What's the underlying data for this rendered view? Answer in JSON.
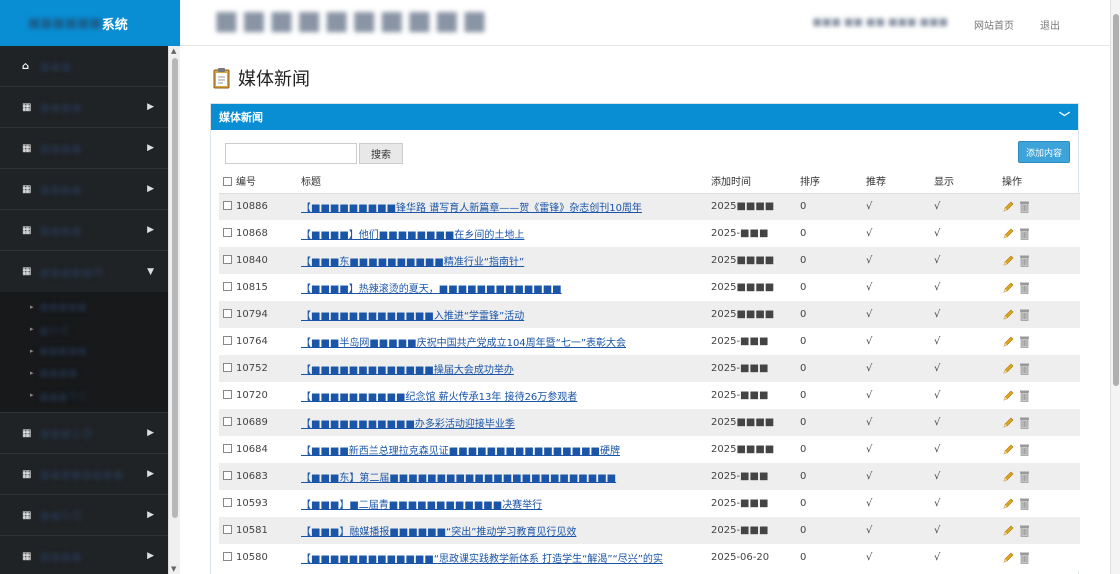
{
  "app": {
    "brand_suffix": "系统",
    "brand_prefix_masked": "■■■■■■",
    "site_title_masked": "■■■■■■■■■■"
  },
  "header": {
    "user_info_masked": "■■■ ■■ ■■ ■■■ ■■■",
    "home_link": "网站首页",
    "logout_link": "退出"
  },
  "sidebar": {
    "items": [
      {
        "label": "■■■",
        "icon": "home-icon",
        "arrow": "",
        "open": false
      },
      {
        "label": "■■■■",
        "icon": "grid-icon",
        "arrow": "▶",
        "open": false
      },
      {
        "label": "■■■■",
        "icon": "grid-icon",
        "arrow": "▶",
        "open": false
      },
      {
        "label": "■■■■",
        "icon": "grid-icon",
        "arrow": "▶",
        "open": false
      },
      {
        "label": "■■■■",
        "icon": "grid-icon",
        "arrow": "▶",
        "open": false
      },
      {
        "label": "■■■■■闻",
        "icon": "grid-icon",
        "arrow": "▼",
        "open": true
      },
      {
        "label": "■■■公告",
        "icon": "grid-icon",
        "arrow": "▶",
        "open": false
      },
      {
        "label": "■■■■■■■■",
        "icon": "grid-icon",
        "arrow": "▶",
        "open": false
      },
      {
        "label": "■■队伍",
        "icon": "grid-icon",
        "arrow": "▶",
        "open": false
      },
      {
        "label": "■■■■",
        "icon": "grid-icon",
        "arrow": "▶",
        "open": false
      }
    ],
    "submenu": [
      "■■■■■",
      "■新闻",
      "■■■■■",
      "■■■■",
      "■■■专栏"
    ]
  },
  "main": {
    "page_title": "媒体新闻",
    "panel_title": "媒体新闻",
    "search_button": "搜索",
    "search_value": "",
    "add_button": "添加内容",
    "columns": {
      "id": "编号",
      "title": "标题",
      "date": "添加时间",
      "sort": "排序",
      "recommend": "推荐",
      "show": "显示",
      "ops": "操作"
    },
    "rows": [
      {
        "id": "10886",
        "title": "【■■■■■■■■■锋华路 谱写育人新篇章——贺《雷锋》杂志创刊10周年",
        "date": "2025■■■■",
        "sort": "0",
        "recommend": "√",
        "show": "√"
      },
      {
        "id": "10868",
        "title": "【■■■■】他们■■■■■■■■在乡间的土地上",
        "date": "2025-■■■",
        "sort": "0",
        "recommend": "√",
        "show": "√"
      },
      {
        "id": "10840",
        "title": "【■■■东■■■■■■■■■■精准行业“指南针”",
        "date": "2025■■■■",
        "sort": "0",
        "recommend": "√",
        "show": "√"
      },
      {
        "id": "10815",
        "title": "【■■■■】热辣滚烫的夏天，■■■■■■■■■■■■■",
        "date": "2025■■■■",
        "sort": "0",
        "recommend": "√",
        "show": "√"
      },
      {
        "id": "10794",
        "title": "【■■■■■■■■■■■■■入推进“学雷锋”活动",
        "date": "2025■■■■",
        "sort": "0",
        "recommend": "√",
        "show": "√"
      },
      {
        "id": "10764",
        "title": "【■■■半岛网■■■■■庆祝中国共产党成立104周年暨“七一”表彰大会",
        "date": "2025-■■■",
        "sort": "0",
        "recommend": "√",
        "show": "√"
      },
      {
        "id": "10752",
        "title": "【■■■■■■■■■■■■■操届大会成功举办",
        "date": "2025-■■■",
        "sort": "0",
        "recommend": "√",
        "show": "√"
      },
      {
        "id": "10720",
        "title": "【■■■■■■■■■■纪念馆 薪火传承13年 接待26万参观者",
        "date": "2025-■■■",
        "sort": "0",
        "recommend": "√",
        "show": "√"
      },
      {
        "id": "10689",
        "title": "【■■■■■■■■■■■办多彩活动迎接毕业季",
        "date": "2025■■■■",
        "sort": "0",
        "recommend": "√",
        "show": "√"
      },
      {
        "id": "10684",
        "title": "【■■■■新西兰总理拉克森见证■■■■■■■■■■■■■■■■硬牌",
        "date": "2025■■■■",
        "sort": "0",
        "recommend": "√",
        "show": "√"
      },
      {
        "id": "10683",
        "title": "【■■■东】第二届■■■■■■■■■■■■■■■■■■■■■■■■",
        "date": "2025-■■■",
        "sort": "0",
        "recommend": "√",
        "show": "√"
      },
      {
        "id": "10593",
        "title": "【■■■】■二届青■■■■■■■■■■■■决赛举行",
        "date": "2025-■■■",
        "sort": "0",
        "recommend": "√",
        "show": "√"
      },
      {
        "id": "10581",
        "title": "【■■■】融媒播报■■■■■■“突出”推动学习教育见行见效",
        "date": "2025-■■■",
        "sort": "0",
        "recommend": "√",
        "show": "√"
      },
      {
        "id": "10580",
        "title": "【■■■■■■■■■■■■■“思政课实践教学新体系 打造学生“解渴”“尽兴”的实",
        "date": "2025-06-20",
        "sort": "0",
        "recommend": "√",
        "show": "√"
      }
    ]
  },
  "colors": {
    "accent": "#0a8ed3",
    "sidebar_bg": "#202326",
    "link": "#1a55a8",
    "edit_icon": "#e0a81c"
  }
}
